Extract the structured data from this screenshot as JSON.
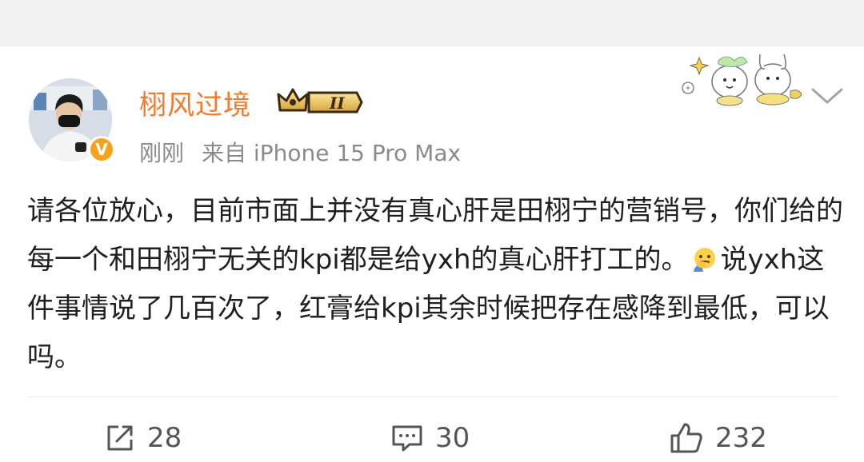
{
  "post": {
    "username": "栩风过境",
    "level_badge": "II",
    "time": "刚刚",
    "source": "来自 iPhone 15 Pro Max",
    "content_parts": [
      "请各位放心，目前市面上并没有真心肝是田栩宁的营销号，你们给的每一个和田栩宁无关的kpi都是给yxh的真心肝打工的。",
      "说yxh这件事情说了几百次了，红膏给kpi其余时候把存在感降到最低，可以吗。"
    ],
    "verified_badge": "V"
  },
  "actions": {
    "repost_count": "28",
    "comment_count": "30",
    "like_count": "232"
  },
  "icons": {
    "repost": "share-icon",
    "comment": "comment-icon",
    "like": "thumbs-up-icon",
    "more": "chevron-down-icon",
    "emoji": "facepalm-emoji-icon"
  },
  "colors": {
    "username": "#f27b2c",
    "meta": "#8a8a8a",
    "badge": "#f7a21b"
  }
}
